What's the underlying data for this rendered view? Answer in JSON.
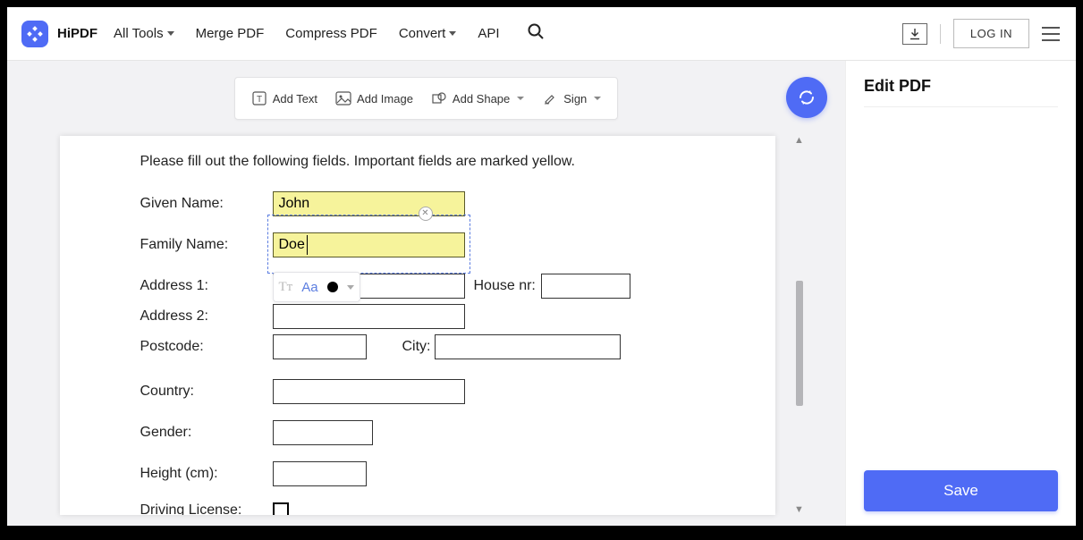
{
  "header": {
    "brand": "HiPDF",
    "nav": {
      "all_tools": "All Tools",
      "merge": "Merge PDF",
      "compress": "Compress PDF",
      "convert": "Convert",
      "api": "API"
    },
    "login": "LOG IN"
  },
  "toolbar": {
    "add_text": "Add Text",
    "add_image": "Add Image",
    "add_shape": "Add Shape",
    "sign": "Sign"
  },
  "page": {
    "instruction": "Please fill out the following fields. Important fields are marked yellow.",
    "labels": {
      "given_name": "Given Name:",
      "family_name": "Family Name:",
      "address1": "Address 1:",
      "address2": "Address 2:",
      "house_nr": "House nr:",
      "postcode": "Postcode:",
      "city": "City:",
      "country": "Country:",
      "gender": "Gender:",
      "height": "Height (cm):",
      "driving": "Driving License:"
    },
    "values": {
      "given_name": "John",
      "family_name": "Doe",
      "address1": "",
      "address2": "",
      "house_nr": "",
      "postcode": "",
      "city": "",
      "country": "",
      "gender": "",
      "height": ""
    },
    "format_bar": {
      "tt": "Tт",
      "aa": "Aa"
    }
  },
  "right_panel": {
    "title": "Edit PDF",
    "save": "Save"
  }
}
